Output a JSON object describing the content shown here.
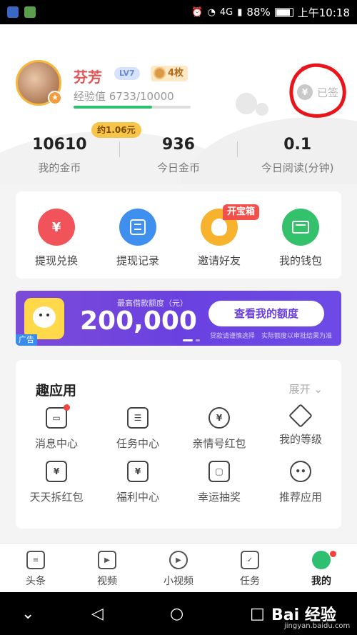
{
  "status_bar": {
    "signal": "4G",
    "battery": "88%",
    "time": "上午10:18"
  },
  "profile": {
    "name": "芬芳",
    "level": "LV7",
    "medals": "4枚",
    "exp_text": "经验值 6733/10000",
    "exp_progress": 0.6733,
    "sign_status": "已签"
  },
  "stats": [
    {
      "value": "10610",
      "label": "我的金币"
    },
    {
      "value": "936",
      "label": "今日金币"
    },
    {
      "value": "0.1",
      "label": "今日阅读(分钟)"
    }
  ],
  "coin_estimate": "约1.06元",
  "actions": [
    {
      "label": "提现兑换",
      "icon": "yuan-icon",
      "color": "#f0545a"
    },
    {
      "label": "提现记录",
      "icon": "record-icon",
      "color": "#3e8fee"
    },
    {
      "label": "邀请好友",
      "icon": "friend-icon",
      "color": "#f7b22e"
    },
    {
      "label": "我的钱包",
      "icon": "wallet-icon",
      "color": "#34c16b"
    }
  ],
  "chest_tag": "开宝箱",
  "banner": {
    "subtitle": "最高借款额度（元）",
    "amount": "200,000",
    "button": "查看我的额度",
    "note": "贷款请谨慎选择　实际额度以审批结果为准",
    "ad_tag": "广告"
  },
  "fun_apps": {
    "title": "趣应用",
    "expand": "展开",
    "items": [
      {
        "label": "消息中心",
        "icon": "message-icon"
      },
      {
        "label": "任务中心",
        "icon": "task-list-icon"
      },
      {
        "label": "亲情号红包",
        "icon": "heart-yuan-icon"
      },
      {
        "label": "我的等级",
        "icon": "diamond-icon"
      },
      {
        "label": "天天拆红包",
        "icon": "red-packet-icon"
      },
      {
        "label": "福利中心",
        "icon": "welfare-icon"
      },
      {
        "label": "幸运抽奖",
        "icon": "lottery-icon"
      },
      {
        "label": "推荐应用",
        "icon": "robot-icon"
      }
    ]
  },
  "tabs": [
    {
      "label": "头条",
      "icon": "news-icon"
    },
    {
      "label": "视频",
      "icon": "video-icon"
    },
    {
      "label": "小视频",
      "icon": "short-video-icon"
    },
    {
      "label": "任务",
      "icon": "task-icon"
    },
    {
      "label": "我的",
      "icon": "me-icon"
    }
  ],
  "watermark": {
    "text": "Bai 经验",
    "sub": "jingyan.baidu.com"
  }
}
